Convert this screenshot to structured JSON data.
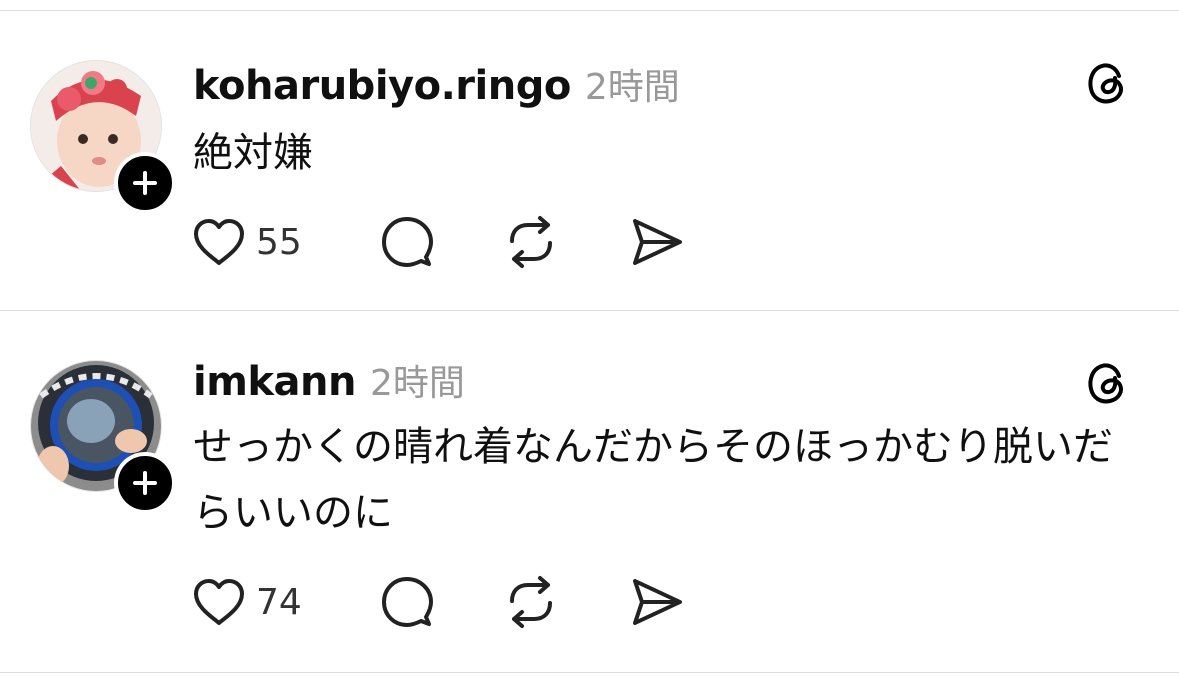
{
  "posts": [
    {
      "username": "koharubiyo.ringo",
      "time": "2時間",
      "text": "絶対嫌",
      "likes": "55"
    },
    {
      "username": "imkann",
      "time": "2時間",
      "text": "せっかくの晴れ着なんだからそのほっかむり脱いだらいいのに",
      "likes": "74"
    }
  ],
  "icons": {
    "like": "heart-icon",
    "reply": "comment-icon",
    "repost": "repost-icon",
    "share": "send-icon",
    "app": "threads-icon",
    "follow": "plus-icon"
  }
}
